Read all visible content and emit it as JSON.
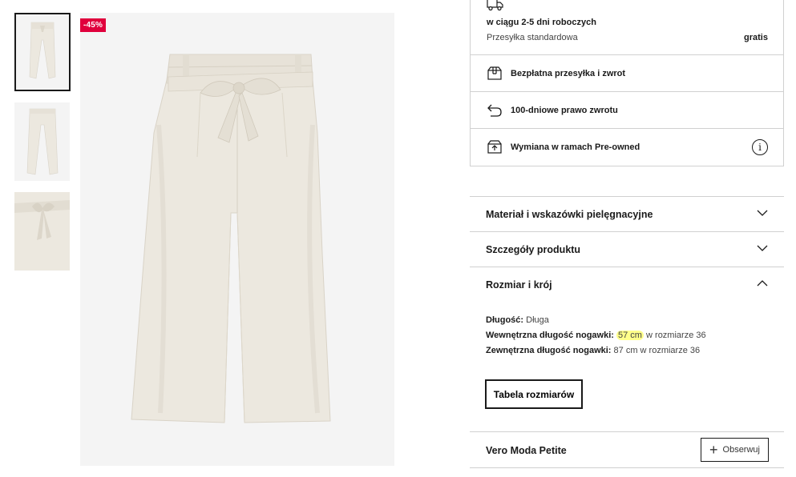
{
  "gallery": {
    "thumbnails": [
      "thumb-front",
      "thumb-back",
      "thumb-detail"
    ],
    "active_index": 0,
    "discount_badge": "-45%"
  },
  "delivery": {
    "days": "w ciągu 2-5 dni roboczych",
    "type": "Przesyłka standardowa",
    "price": "gratis",
    "rows": [
      {
        "label": "Bezpłatna przesyłka i zwrot",
        "icon": "box-icon"
      },
      {
        "label": "100-dniowe prawo zwrotu",
        "icon": "return-arrow-icon"
      },
      {
        "label": "Wymiana w ramach Pre-owned",
        "icon": "preowned-box-icon"
      }
    ]
  },
  "accordion": {
    "material": "Materiał i wskazówki pielęgnacyjne",
    "details": "Szczegóły produktu",
    "size_fit": "Rozmiar i krój"
  },
  "size_fit": {
    "length_label": "Długość:",
    "length_value": "Długa",
    "inner_label": "Wewnętrzna długość nogawki:",
    "inner_value": "57 cm",
    "inner_suffix": "w rozmiarze 36",
    "outer_label": "Zewnętrzna długość nogawki:",
    "outer_value": "87 cm w rozmiarze 36",
    "size_table_button": "Tabela rozmiarów"
  },
  "brand": {
    "name": "Vero Moda Petite",
    "follow_label": "Obserwuj"
  },
  "colors": {
    "badge": "#e0003c",
    "highlight": "#ffff8a",
    "fabric": "#ece8df"
  }
}
